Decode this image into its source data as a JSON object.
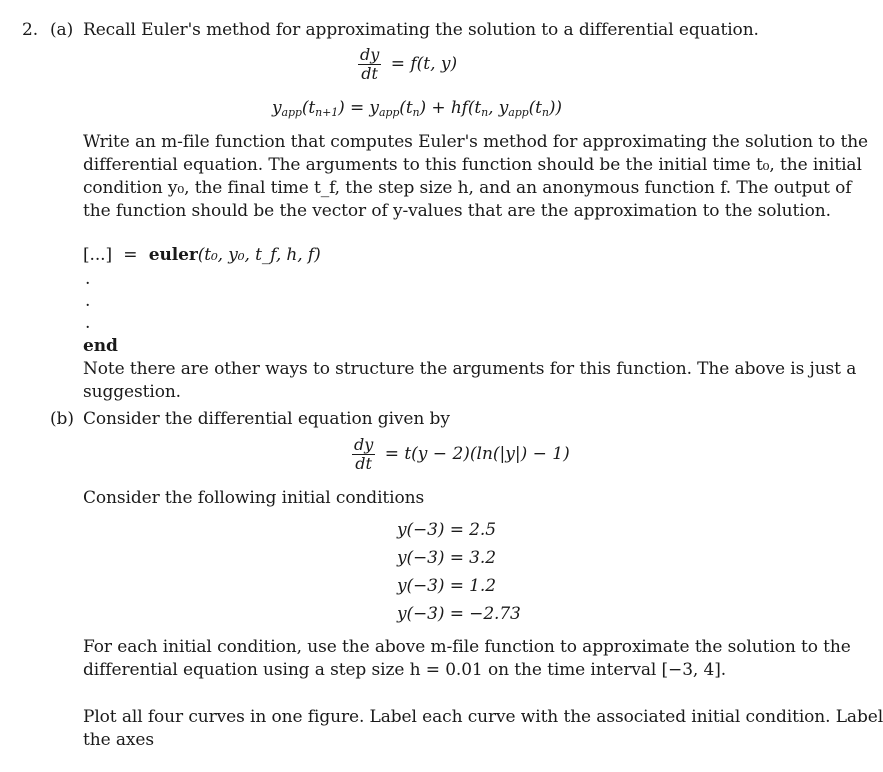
{
  "problem": {
    "number": "2.",
    "part_a": {
      "label": "(a)",
      "intro": "Recall Euler's method for approximating the solution to a differential equation.",
      "eq1": {
        "num": "dy",
        "den": "dt",
        "rhs": "= f(t, y)"
      },
      "eq2": {
        "lhs_y": "y",
        "lhs_sub": "app",
        "lhs_arg": "(t",
        "lhs_arg_sub": "n+1",
        "lhs_close": ")",
        "rhs": " = y",
        "rhs_sub": "app",
        "rhs_arg": "(t",
        "rhs_arg_sub": "n",
        "rhs_mid": ") + hf(t",
        "rhs_mid_sub": "n",
        "rhs_comma": ", y",
        "rhs_sub2": "app",
        "rhs_arg2": "(t",
        "rhs_arg2_sub": "n",
        "rhs_end": "))"
      },
      "paragraph_lines": [
        "Write an m-file function that computes Euler's method for approximating the solution to the",
        "differential equation. The arguments to this function should be the initial time t₀, the initial",
        "condition y₀, the final time t_f, the step size h, and an anonymous function f. The output of",
        "the function should be the vector of y-values that are the approximation to the solution."
      ],
      "code": {
        "signature_lhs": "[...]",
        "signature_eq": "=",
        "signature_fn": "euler",
        "signature_args": "(t₀, y₀, t_f, h, f)",
        "dots": [
          ".",
          ".",
          "."
        ],
        "end": "end"
      },
      "note_lines": [
        "Note there are other ways to structure the arguments for this function. The above is just a",
        "suggestion."
      ]
    },
    "part_b": {
      "label": "(b)",
      "intro": "Consider the differential equation given by",
      "equation": {
        "num": "dy",
        "den": "dt",
        "rhs": "= t(y − 2)(ln(|y|) − 1)"
      },
      "conditions_intro": "Consider the following initial conditions",
      "initial_conditions": [
        "y(−3) = 2.5",
        "y(−3) = 3.2",
        "y(−3) = 1.2",
        "y(−3) = −2.73"
      ],
      "instruction_lines": [
        "For each initial condition, use the above m-file function to approximate the solution to the",
        "differential equation using a step size h = 0.01 on the time interval [−3, 4]."
      ],
      "plot_lines": [
        "Plot all four curves in one figure. Label each curve with the associated initial condition. Label",
        "the axes"
      ]
    }
  }
}
